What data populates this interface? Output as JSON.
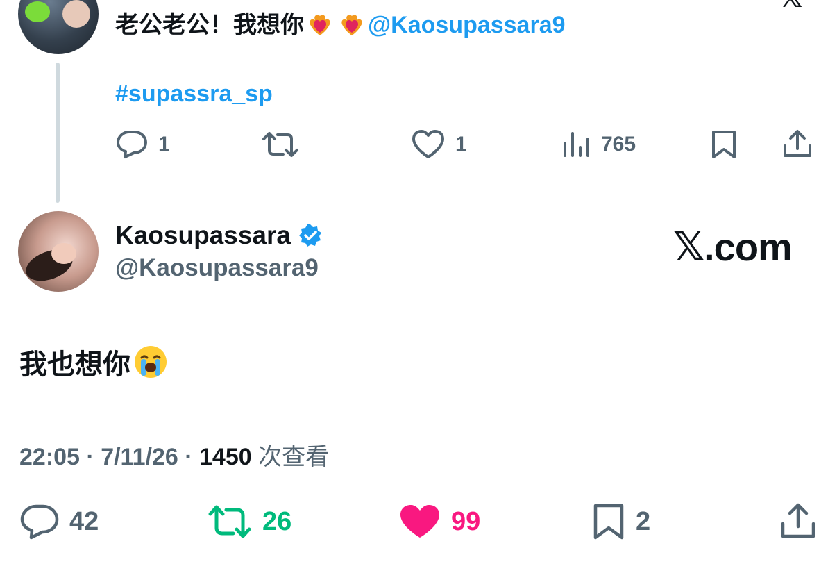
{
  "parent_tweet": {
    "text_prefix": "老公老公！我想你",
    "mention": "@Kaosupassara9",
    "hashtag": "#supassra_sp",
    "reply_count": "1",
    "retweet_count": "",
    "like_count": "1",
    "view_count": "765"
  },
  "main_tweet": {
    "display_name": "Kaosupassara",
    "handle": "@Kaosupassara9",
    "text": "我也想你",
    "time": "22:05",
    "date": "7/11/26",
    "views_count": "1450",
    "views_label": "次查看",
    "reply_count": "42",
    "retweet_count": "26",
    "like_count": "99",
    "bookmark_count": "2"
  },
  "brand": {
    "x_logo": "𝕏",
    "domain_suffix": ".com",
    "corner_logo": "𝕏"
  },
  "colors": {
    "link_blue": "#1d9bf0",
    "retweet_green": "#00ba7c",
    "like_pink": "#f91880",
    "muted": "#536471",
    "verified_blue": "#1d9bf0"
  },
  "icons": {
    "heart_fire": "heart-on-fire-emoji",
    "crying": "loudly-crying-face-emoji"
  }
}
